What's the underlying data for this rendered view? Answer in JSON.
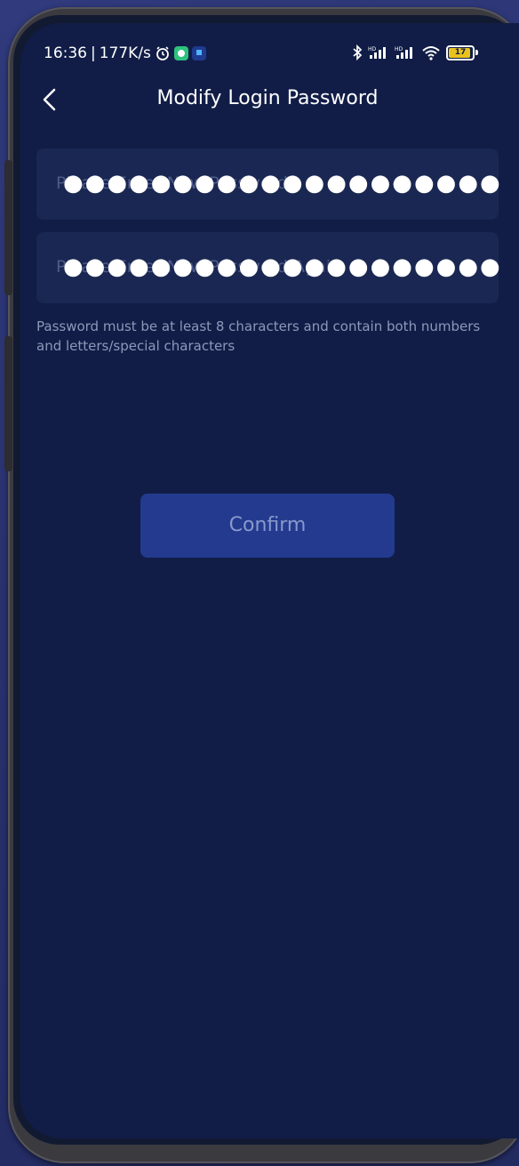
{
  "status_bar": {
    "time": "16:36",
    "separator": "|",
    "network_speed": "177K/s",
    "battery_level": "17",
    "battery_color": "#e9c21c",
    "left_icons": [
      "alarm-icon",
      "app-notification-icon",
      "flag-notification-icon"
    ],
    "right_icons": [
      "bluetooth-icon",
      "hd-signal-icon",
      "hd-signal-icon",
      "wifi-icon",
      "battery-icon"
    ]
  },
  "header": {
    "title": "Modify Login Password",
    "back_icon": "chevron-left-icon"
  },
  "form": {
    "new_password": {
      "placeholder": "Please Enter New Password",
      "masked_value": "●●●●●●●●●●●●●●●●●●●●"
    },
    "confirm_password": {
      "placeholder": "Please Enter New Password Again",
      "masked_value": "●●●●●●●●●●●●●●●●●●●●"
    },
    "hint": "Password must be at least 8 characters and contain both numbers and letters/special characters",
    "confirm_label": "Confirm"
  },
  "colors": {
    "background": "#111d47",
    "field_background": "#1a2752",
    "button_background": "#243a8f",
    "button_text": "#8899cc"
  }
}
